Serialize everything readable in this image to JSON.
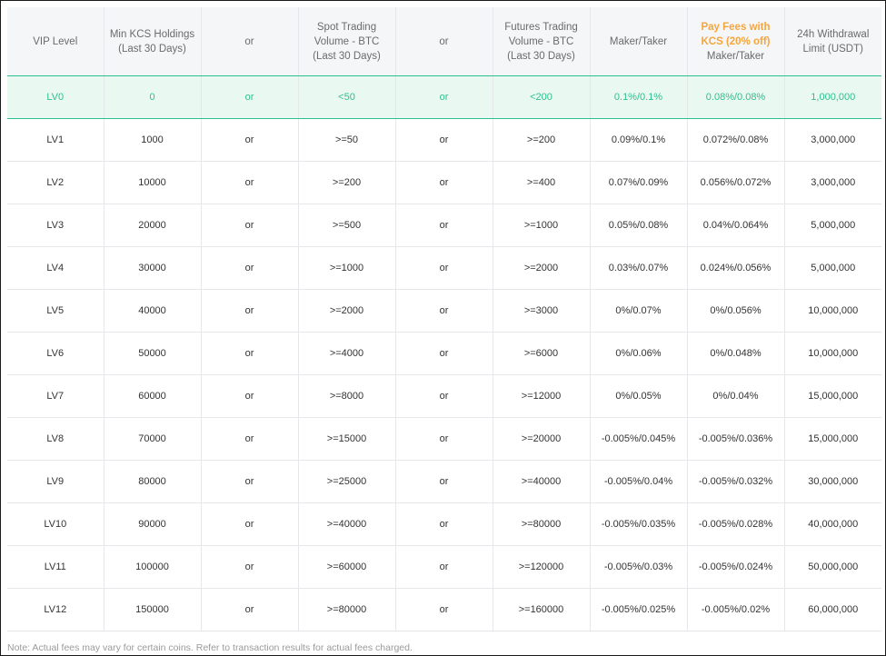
{
  "headers": {
    "vip_level": "VIP Level",
    "min_kcs": "Min KCS Holdings (Last 30 Days)",
    "or_1": "or",
    "spot": "Spot Trading Volume - BTC (Last 30 Days)",
    "or_2": "or",
    "futures": "Futures Trading Volume - BTC (Last 30 Days)",
    "maker_taker": "Maker/Taker",
    "kcs_fees_highlight": "Pay Fees with KCS (20% off)",
    "kcs_fees_sub": "Maker/Taker",
    "withdrawal": "24h Withdrawal Limit (USDT)"
  },
  "rows": [
    {
      "level": "LV0",
      "kcs": "0",
      "or1": "or",
      "spot": "<50",
      "or2": "or",
      "futures": "<200",
      "fee": "0.1%/0.1%",
      "kcs_fee": "0.08%/0.08%",
      "withdrawal": "1,000,000"
    },
    {
      "level": "LV1",
      "kcs": "1000",
      "or1": "or",
      "spot": ">=50",
      "or2": "or",
      "futures": ">=200",
      "fee": "0.09%/0.1%",
      "kcs_fee": "0.072%/0.08%",
      "withdrawal": "3,000,000"
    },
    {
      "level": "LV2",
      "kcs": "10000",
      "or1": "or",
      "spot": ">=200",
      "or2": "or",
      "futures": ">=400",
      "fee": "0.07%/0.09%",
      "kcs_fee": "0.056%/0.072%",
      "withdrawal": "3,000,000"
    },
    {
      "level": "LV3",
      "kcs": "20000",
      "or1": "or",
      "spot": ">=500",
      "or2": "or",
      "futures": ">=1000",
      "fee": "0.05%/0.08%",
      "kcs_fee": "0.04%/0.064%",
      "withdrawal": "5,000,000"
    },
    {
      "level": "LV4",
      "kcs": "30000",
      "or1": "or",
      "spot": ">=1000",
      "or2": "or",
      "futures": ">=2000",
      "fee": "0.03%/0.07%",
      "kcs_fee": "0.024%/0.056%",
      "withdrawal": "5,000,000"
    },
    {
      "level": "LV5",
      "kcs": "40000",
      "or1": "or",
      "spot": ">=2000",
      "or2": "or",
      "futures": ">=3000",
      "fee": "0%/0.07%",
      "kcs_fee": "0%/0.056%",
      "withdrawal": "10,000,000"
    },
    {
      "level": "LV6",
      "kcs": "50000",
      "or1": "or",
      "spot": ">=4000",
      "or2": "or",
      "futures": ">=6000",
      "fee": "0%/0.06%",
      "kcs_fee": "0%/0.048%",
      "withdrawal": "10,000,000"
    },
    {
      "level": "LV7",
      "kcs": "60000",
      "or1": "or",
      "spot": ">=8000",
      "or2": "or",
      "futures": ">=12000",
      "fee": "0%/0.05%",
      "kcs_fee": "0%/0.04%",
      "withdrawal": "15,000,000"
    },
    {
      "level": "LV8",
      "kcs": "70000",
      "or1": "or",
      "spot": ">=15000",
      "or2": "or",
      "futures": ">=20000",
      "fee": "-0.005%/0.045%",
      "kcs_fee": "-0.005%/0.036%",
      "withdrawal": "15,000,000"
    },
    {
      "level": "LV9",
      "kcs": "80000",
      "or1": "or",
      "spot": ">=25000",
      "or2": "or",
      "futures": ">=40000",
      "fee": "-0.005%/0.04%",
      "kcs_fee": "-0.005%/0.032%",
      "withdrawal": "30,000,000"
    },
    {
      "level": "LV10",
      "kcs": "90000",
      "or1": "or",
      "spot": ">=40000",
      "or2": "or",
      "futures": ">=80000",
      "fee": "-0.005%/0.035%",
      "kcs_fee": "-0.005%/0.028%",
      "withdrawal": "40,000,000"
    },
    {
      "level": "LV11",
      "kcs": "100000",
      "or1": "or",
      "spot": ">=60000",
      "or2": "or",
      "futures": ">=120000",
      "fee": "-0.005%/0.03%",
      "kcs_fee": "-0.005%/0.024%",
      "withdrawal": "50,000,000"
    },
    {
      "level": "LV12",
      "kcs": "150000",
      "or1": "or",
      "spot": ">=80000",
      "or2": "or",
      "futures": ">=160000",
      "fee": "-0.005%/0.025%",
      "kcs_fee": "-0.005%/0.02%",
      "withdrawal": "60,000,000"
    }
  ],
  "note": "Note: Actual fees may vary for certain coins. Refer to transaction results for actual fees charged.",
  "colors": {
    "accent_green": "#2fbf8f",
    "highlight_orange": "#f5a53b",
    "current_row_bg": "#eaf8f2",
    "header_bg": "#f5f6f8"
  }
}
